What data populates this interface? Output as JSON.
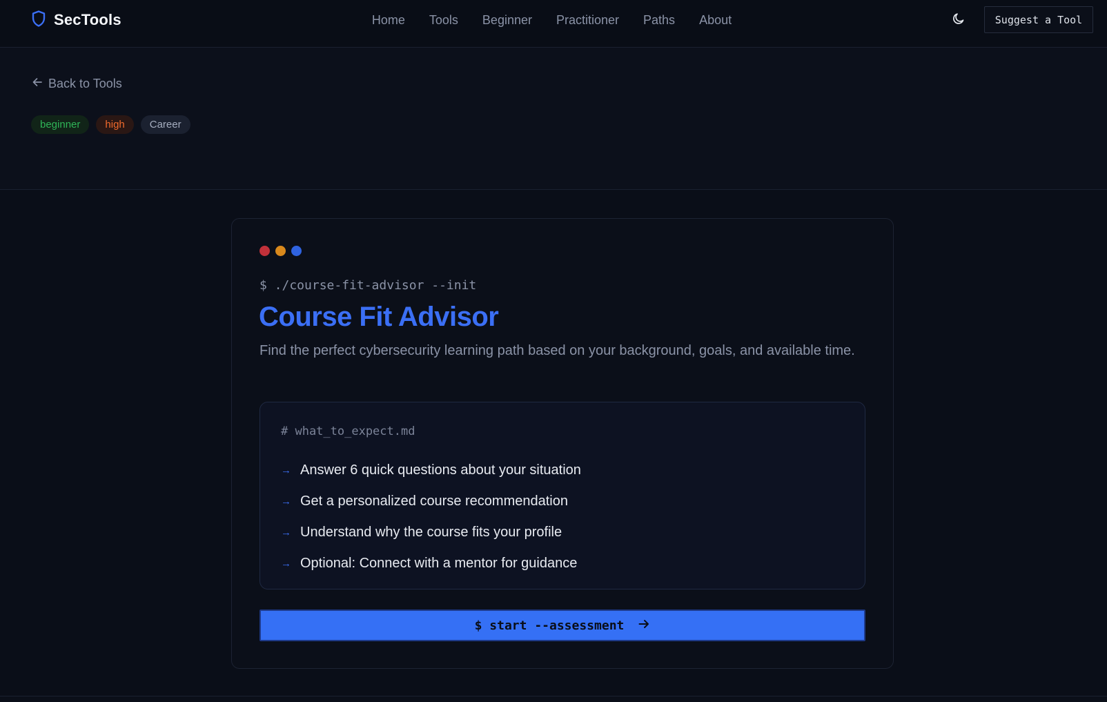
{
  "brand": {
    "name": "SecTools",
    "logo_icon": "shield-icon"
  },
  "nav": {
    "items": [
      "Home",
      "Tools",
      "Beginner",
      "Practitioner",
      "Paths",
      "About"
    ]
  },
  "header": {
    "theme_icon": "moon-icon",
    "suggest_label": "Suggest a Tool"
  },
  "hero": {
    "back_label": "Back to Tools",
    "tags": [
      "beginner",
      "high",
      "Career"
    ]
  },
  "card": {
    "window_dots": [
      "#d33a3a",
      "#e08a1e",
      "#2f63e0"
    ],
    "command": "$ ./course-fit-advisor --init",
    "title": "Course Fit Advisor",
    "subtitle": "Find the perfect cybersecurity learning path based on your background, goals, and available time.",
    "expect": {
      "heading": "# what_to_expect.md",
      "items": [
        "Answer 6 quick questions about your situation",
        "Get a personalized course recommendation",
        "Understand why the course fits your profile",
        "Optional: Connect with a mentor for guidance"
      ],
      "bullet": "→"
    },
    "start_button": {
      "label": "$ start --assessment",
      "icon": "arrow-right-icon"
    }
  },
  "colors": {
    "accent": "#3570f5",
    "background": "#0b0f19"
  }
}
